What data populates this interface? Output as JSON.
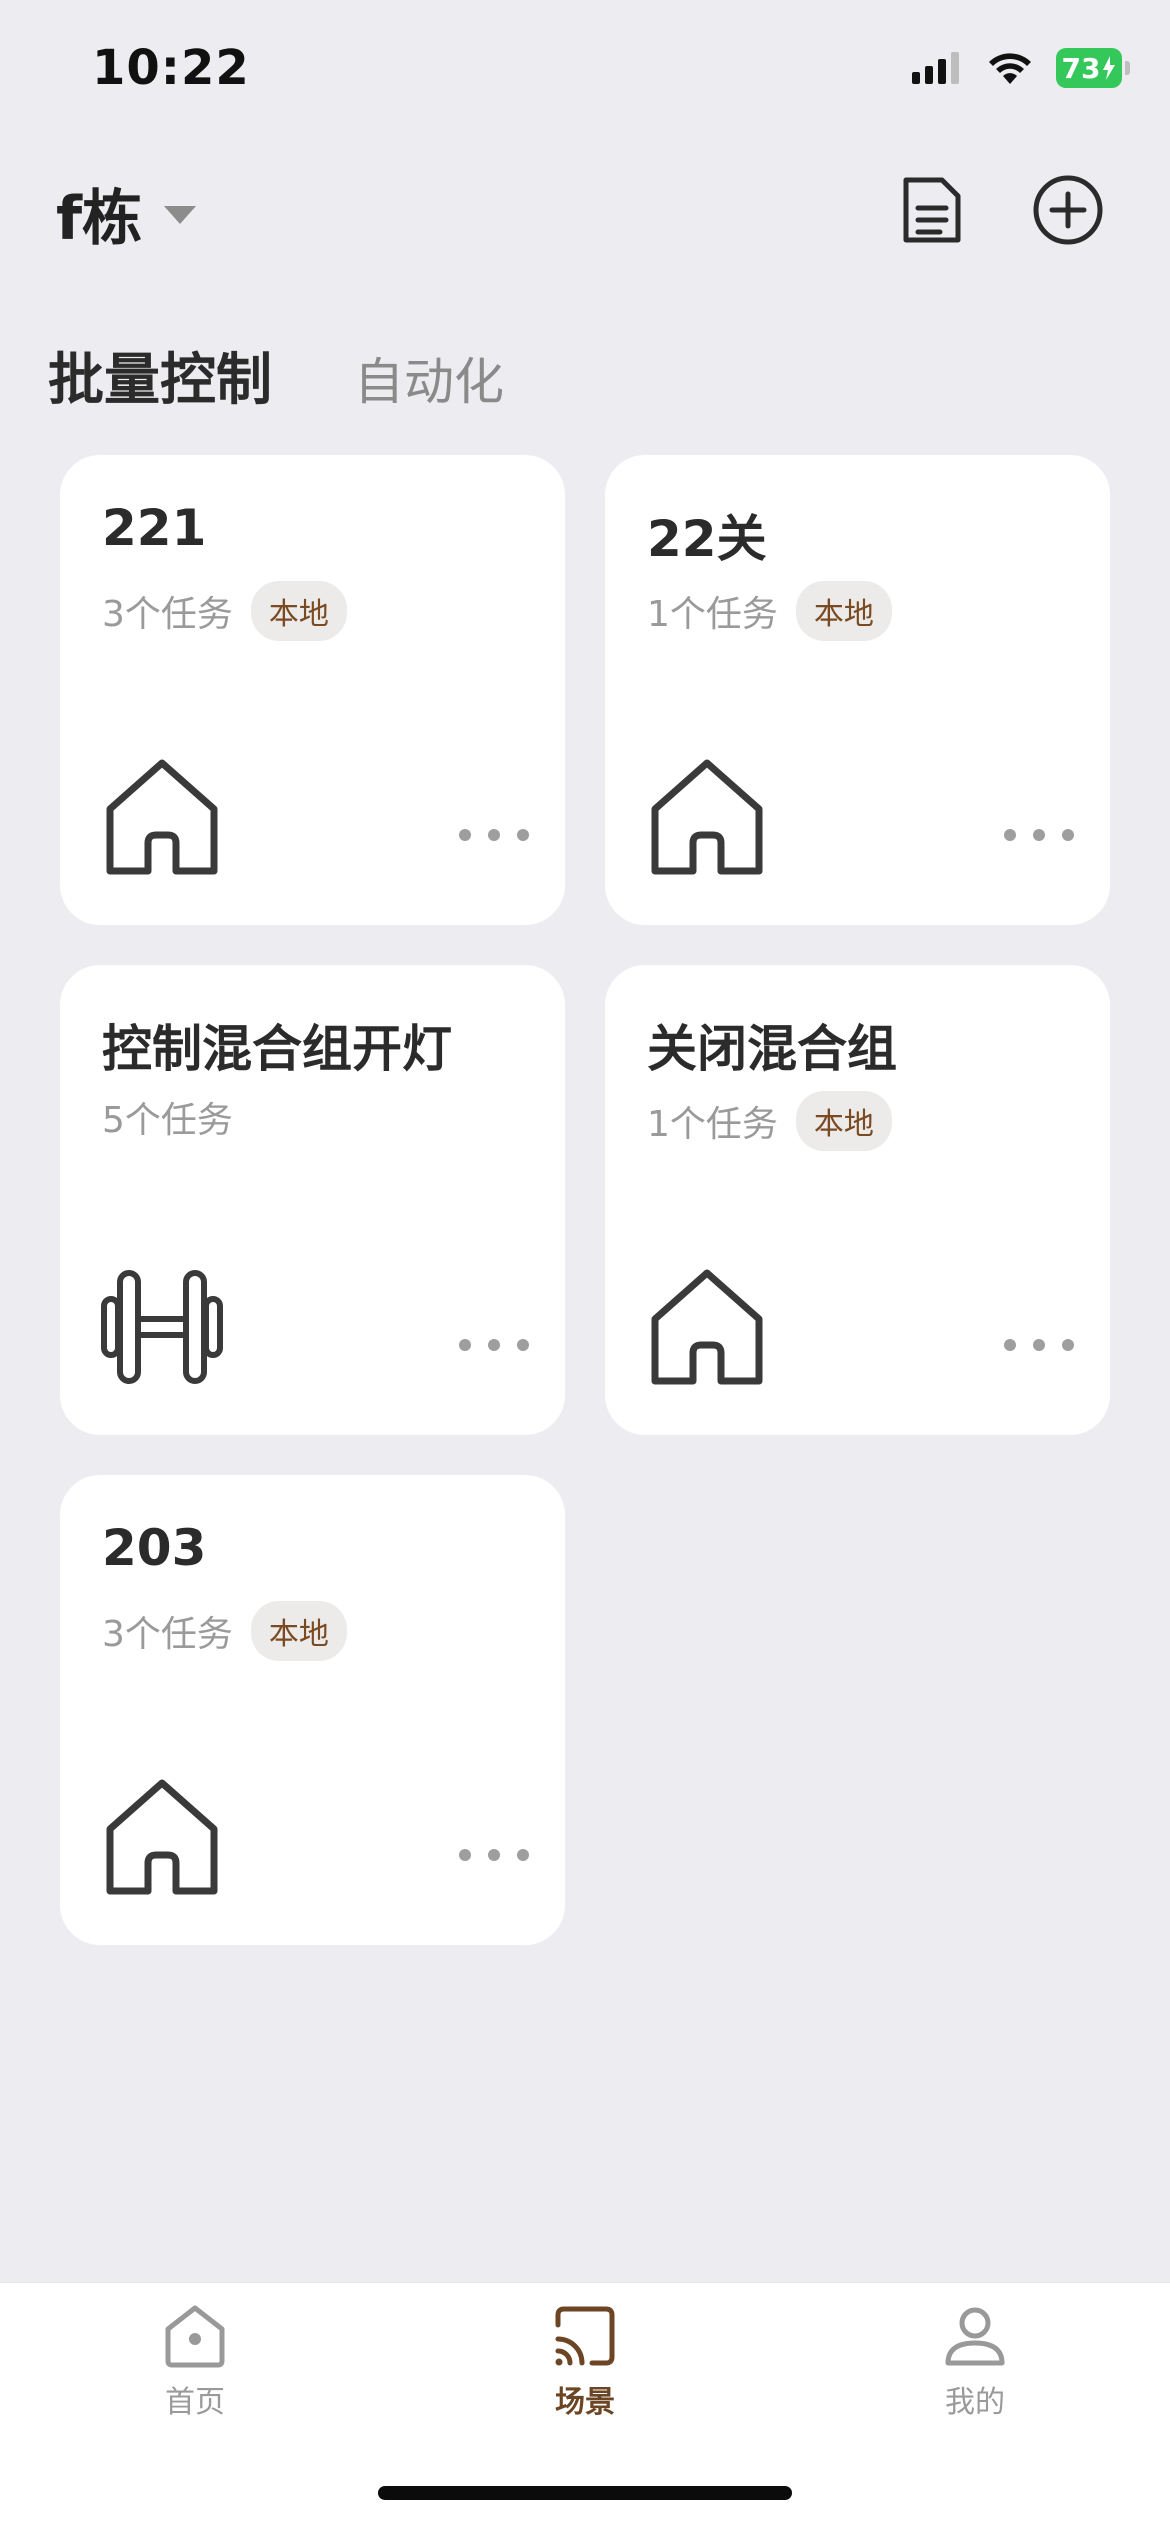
{
  "status": {
    "time": "10:22",
    "battery": "73"
  },
  "header": {
    "building": "f栋"
  },
  "tabs": [
    {
      "label": "批量控制"
    },
    {
      "label": "自动化"
    }
  ],
  "cards": [
    {
      "title": "221",
      "tasks": "3个任务",
      "badge": "本地",
      "icon": "house-icon"
    },
    {
      "title": "22关",
      "tasks": "1个任务",
      "badge": "本地",
      "icon": "house-icon"
    },
    {
      "title": "控制混合组开灯",
      "tasks": "5个任务",
      "badge": "",
      "icon": "dumbbell-icon"
    },
    {
      "title": "关闭混合组",
      "tasks": "1个任务",
      "badge": "本地",
      "icon": "house-icon"
    },
    {
      "title": "203",
      "tasks": "3个任务",
      "badge": "本地",
      "icon": "house-icon"
    }
  ],
  "tabbar": [
    {
      "label": "首页",
      "icon": "home-icon",
      "active": false
    },
    {
      "label": "场景",
      "icon": "scene-icon",
      "active": true
    },
    {
      "label": "我的",
      "icon": "profile-icon",
      "active": false
    }
  ],
  "colors": {
    "background": "#EDEDF1",
    "accent": "#6B4524",
    "badge_text": "#7A4A22",
    "battery": "#34C759"
  }
}
